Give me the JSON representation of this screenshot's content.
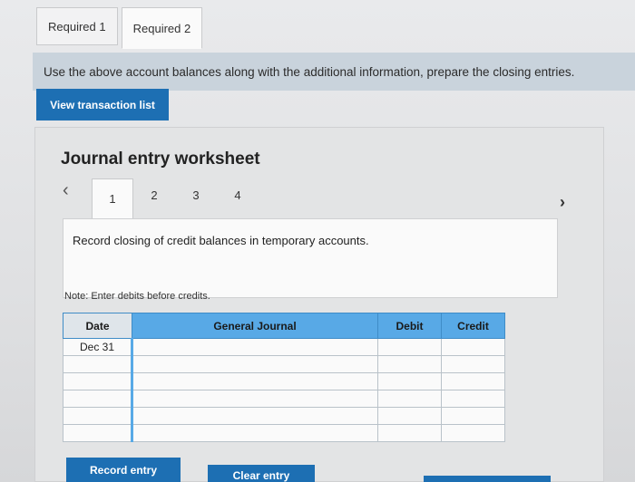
{
  "tabs": [
    {
      "label": "Required 1"
    },
    {
      "label": "Required 2"
    }
  ],
  "instruction": "Use the above account balances along with the additional information, prepare the closing entries.",
  "view_transaction_label": "View transaction list",
  "worksheet": {
    "title": "Journal entry worksheet",
    "prev_icon": "chevron-left-icon",
    "next_icon": "chevron-right-icon",
    "steps": [
      "1",
      "2",
      "3",
      "4"
    ],
    "active_step": "1",
    "description": "Record closing of credit balances in temporary accounts.",
    "note": "Note: Enter debits before credits.",
    "table": {
      "headers": {
        "date": "Date",
        "general_journal": "General Journal",
        "debit": "Debit",
        "credit": "Credit"
      },
      "rows": [
        {
          "date": "Dec 31",
          "account": "",
          "debit": "",
          "credit": ""
        },
        {
          "date": "",
          "account": "",
          "debit": "",
          "credit": ""
        },
        {
          "date": "",
          "account": "",
          "debit": "",
          "credit": ""
        },
        {
          "date": "",
          "account": "",
          "debit": "",
          "credit": ""
        },
        {
          "date": "",
          "account": "",
          "debit": "",
          "credit": ""
        },
        {
          "date": "",
          "account": "",
          "debit": "",
          "credit": ""
        }
      ]
    },
    "record_entry_label": "Record entry",
    "clear_entry_label": "Clear entry"
  },
  "colors": {
    "accent": "#1d6fb3",
    "header_blue": "#58a9e6",
    "instruction_bg": "#c9d3dc"
  }
}
